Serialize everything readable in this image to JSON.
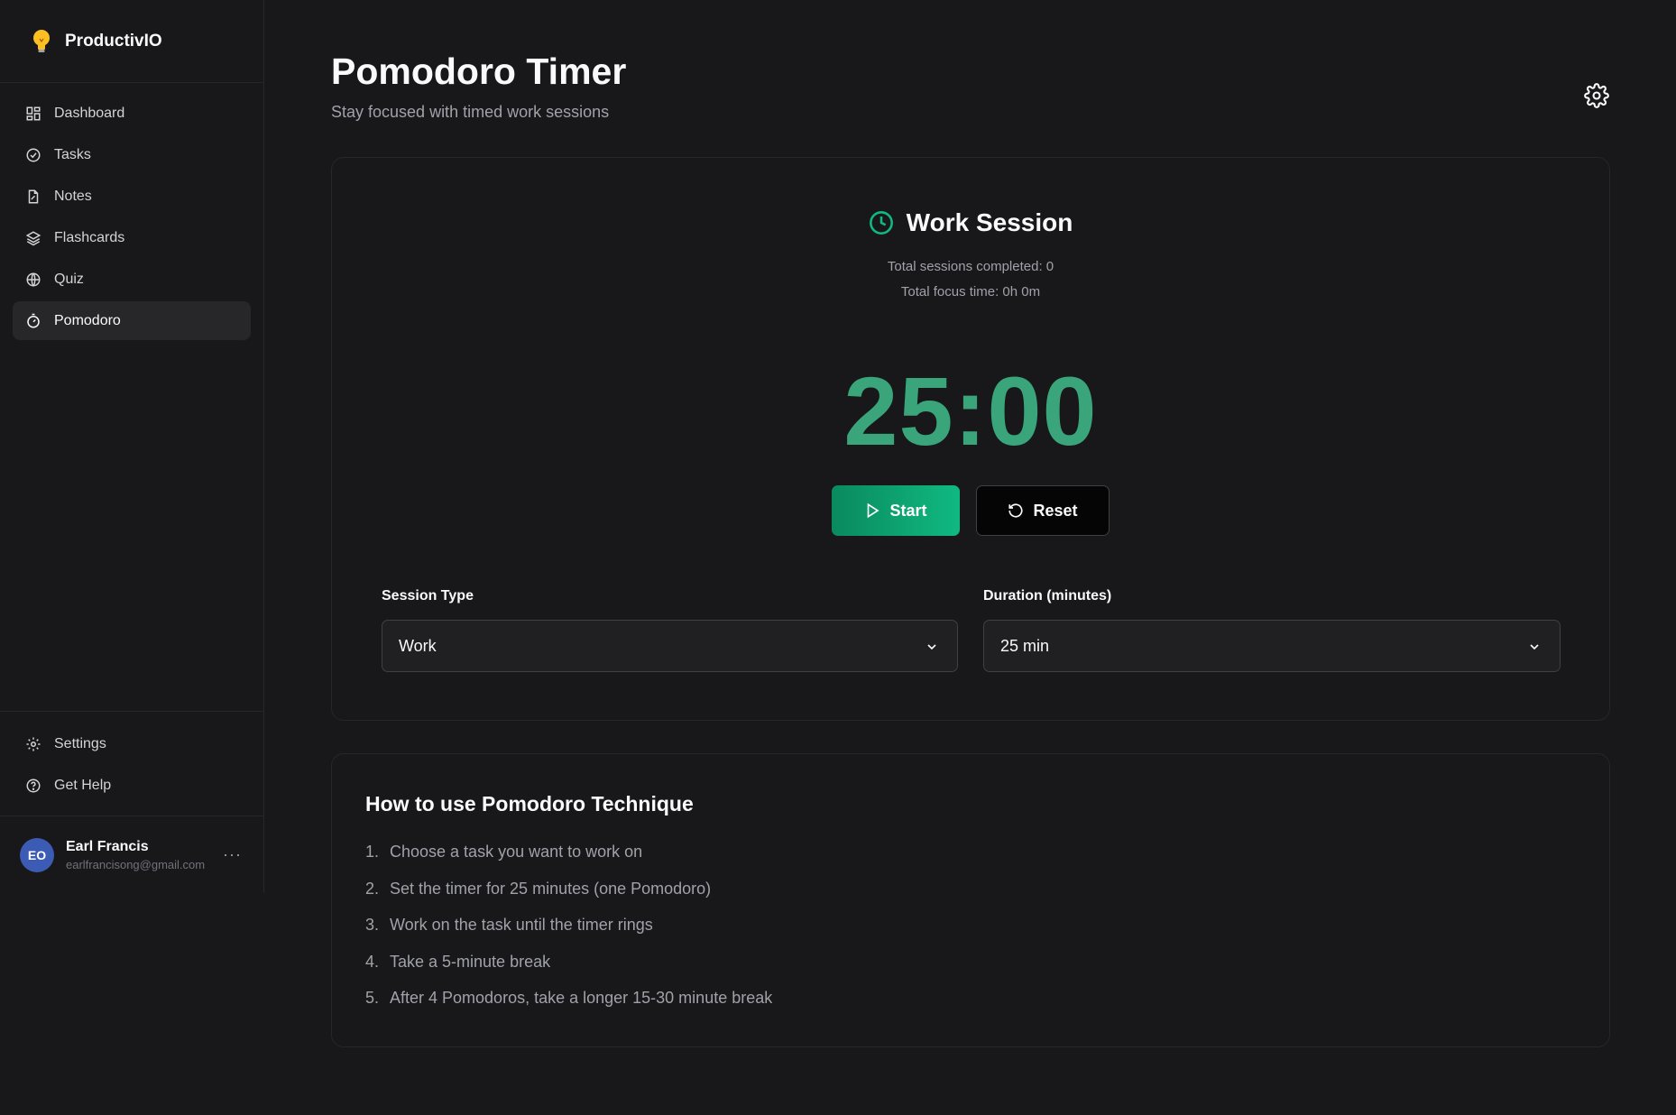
{
  "app": {
    "brand_name": "ProductivIO",
    "brand_icon": "lightbulb-icon",
    "accent_color": "#10b981",
    "timer_color": "#3aa57a"
  },
  "sidebar": {
    "items": [
      {
        "label": "Dashboard",
        "icon": "grid-icon",
        "active": false
      },
      {
        "label": "Tasks",
        "icon": "check-circle-icon",
        "active": false
      },
      {
        "label": "Notes",
        "icon": "note-icon",
        "active": false
      },
      {
        "label": "Flashcards",
        "icon": "layers-icon",
        "active": false
      },
      {
        "label": "Quiz",
        "icon": "globe-icon",
        "active": false
      },
      {
        "label": "Pomodoro",
        "icon": "timer-icon",
        "active": true
      }
    ],
    "bottom_items": [
      {
        "label": "Settings",
        "icon": "gear-icon"
      },
      {
        "label": "Get Help",
        "icon": "help-circle-icon"
      }
    ],
    "user": {
      "initials": "EO",
      "name": "Earl Francis",
      "email": "earlfrancisong@gmail.com",
      "more": "···"
    }
  },
  "header": {
    "title": "Pomodoro Timer",
    "subtitle": "Stay focused with timed work sessions"
  },
  "timer_card": {
    "session_title": "Work Session",
    "sessions_completed": "Total sessions completed: 0",
    "focus_time": "Total focus time: 0h 0m",
    "time": "25:00",
    "start_label": "Start",
    "reset_label": "Reset",
    "session_type_label": "Session Type",
    "session_type_value": "Work",
    "duration_label": "Duration (minutes)",
    "duration_value": "25 min"
  },
  "help_card": {
    "title": "How to use Pomodoro Technique",
    "steps": [
      {
        "num": "1.",
        "text": "Choose a task you want to work on"
      },
      {
        "num": "2.",
        "text": "Set the timer for 25 minutes (one Pomodoro)"
      },
      {
        "num": "3.",
        "text": "Work on the task until the timer rings"
      },
      {
        "num": "4.",
        "text": "Take a 5-minute break"
      },
      {
        "num": "5.",
        "text": "After 4 Pomodoros, take a longer 15-30 minute break"
      }
    ]
  }
}
